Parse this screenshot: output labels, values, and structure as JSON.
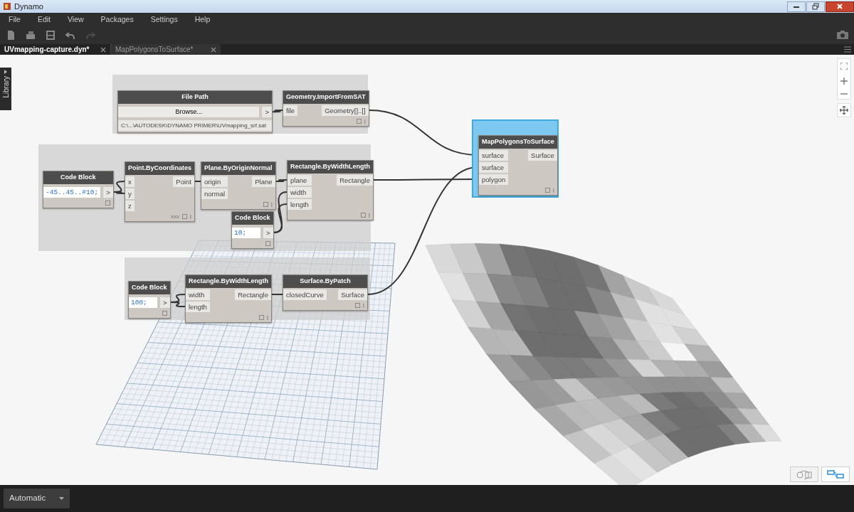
{
  "window": {
    "title": "Dynamo"
  },
  "menu": [
    "File",
    "Edit",
    "View",
    "Packages",
    "Settings",
    "Help"
  ],
  "toolbar": [
    {
      "kind": "new",
      "disabled": false
    },
    {
      "kind": "open",
      "disabled": false
    },
    {
      "kind": "save",
      "disabled": false
    },
    {
      "kind": "undo",
      "disabled": false
    },
    {
      "kind": "redo",
      "disabled": true
    }
  ],
  "tabs": [
    {
      "label": "UVmapping-capture.dyn*",
      "selected": true
    },
    {
      "label": "MapPolygonsToSurface*",
      "selected": false
    }
  ],
  "sidebar": {
    "label": "Library"
  },
  "nodes": [
    {
      "title": "File Path",
      "kind": "filepath",
      "button": "Browse...",
      "outputs": [
        ">"
      ],
      "path": "C:\\...\\AUTODESK\\DYNAMO PRIMER\\UVmapping_srf.sat",
      "selected": false
    },
    {
      "title": "Geometry.ImportFromSAT",
      "kind": "function",
      "inputs": [
        "file"
      ],
      "outputs": [
        "Geometry[]..[]"
      ],
      "selected": false
    },
    {
      "title": "Code Block",
      "kind": "code",
      "code": "-45..45..#10;",
      "outputs": [
        ">"
      ],
      "selected": false
    },
    {
      "title": "Point.ByCoordinates",
      "kind": "function",
      "inputs": [
        "x",
        "y",
        "z"
      ],
      "outputs": [
        "Point"
      ],
      "lacing": "xxx",
      "selected": false
    },
    {
      "title": "Plane.ByOriginNormal",
      "kind": "function",
      "inputs": [
        "origin",
        "normal"
      ],
      "outputs": [
        "Plane"
      ],
      "selected": false
    },
    {
      "title": "Rectangle.ByWidthLength",
      "kind": "function",
      "inputs": [
        "plane",
        "width",
        "length"
      ],
      "outputs": [
        "Rectangle"
      ],
      "selected": false
    },
    {
      "title": "Code Block",
      "kind": "code",
      "code": "10;",
      "outputs": [
        ">"
      ],
      "selected": false
    },
    {
      "title": "Code Block",
      "kind": "code",
      "code": "100;",
      "outputs": [
        ">"
      ],
      "selected": false
    },
    {
      "title": "Rectangle.ByWidthLength",
      "kind": "function",
      "inputs": [
        "width",
        "length"
      ],
      "outputs": [
        "Rectangle"
      ],
      "selected": false
    },
    {
      "title": "Surface.ByPatch",
      "kind": "function",
      "inputs": [
        "closedCurve"
      ],
      "outputs": [
        "Surface"
      ],
      "selected": false
    },
    {
      "title": "MapPolygonsToSurface",
      "kind": "function",
      "inputs": [
        "surface",
        "surface",
        "polygon"
      ],
      "outputs": [
        "Surface"
      ],
      "selected": true
    }
  ],
  "view_toggle": [
    {
      "kind": "geometry",
      "selected": false
    },
    {
      "kind": "graph",
      "selected": true
    }
  ],
  "run_mode": "Automatic"
}
